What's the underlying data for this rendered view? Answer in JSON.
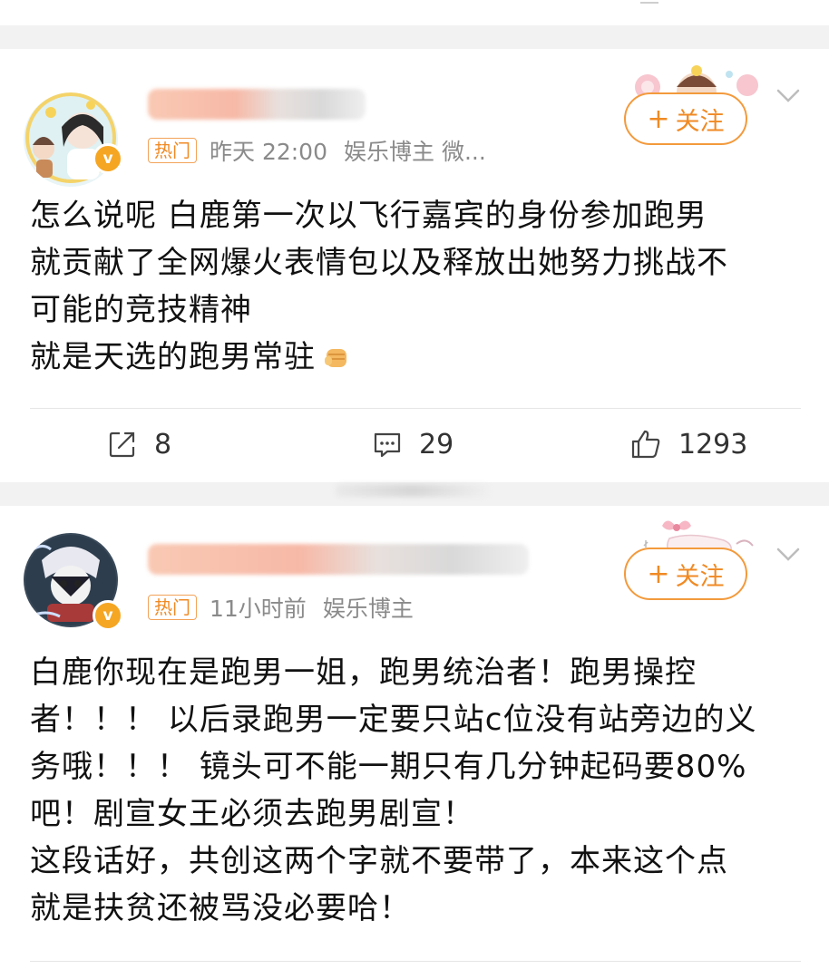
{
  "posts": [
    {
      "hot_badge": "热门",
      "time": "昨天 22:00",
      "source": "娱乐博主 微...",
      "follow_label": "关注",
      "follow_plus": "+",
      "verified": "v",
      "content_lines": [
        "怎么说呢 白鹿第一次以飞行嘉宾的身份参加跑男",
        "就贡献了全网爆火表情包以及释放出她努力挑战不",
        "可能的竞技精神",
        "就是天选的跑男常驻"
      ],
      "reposts": "8",
      "comments": "29",
      "likes": "1293"
    },
    {
      "hot_badge": "热门",
      "time": "11小时前",
      "source": "娱乐博主",
      "follow_label": "关注",
      "follow_plus": "+",
      "verified": "v",
      "content_lines": [
        "白鹿你现在是跑男一姐，跑男统治者！跑男操控",
        "者！！！ 以后录跑男一定要只站c位没有站旁边的义",
        "务哦！！！ 镜头可不能一期只有几分钟起码要80%",
        "吧！剧宣女王必须去跑男剧宣！",
        "这段话好，共创这两个字就不要带了，本来这个点",
        "就是扶贫还被骂没必要哈！"
      ]
    }
  ],
  "colors": {
    "accent": "#f08a24",
    "divider": "#e6e6e6",
    "background_gap": "#f2f2f2",
    "meta_text": "#8a8a8a"
  },
  "icons": [
    "repost-icon",
    "comment-icon",
    "like-icon",
    "chevron-down-icon",
    "fist-emoji-icon"
  ]
}
